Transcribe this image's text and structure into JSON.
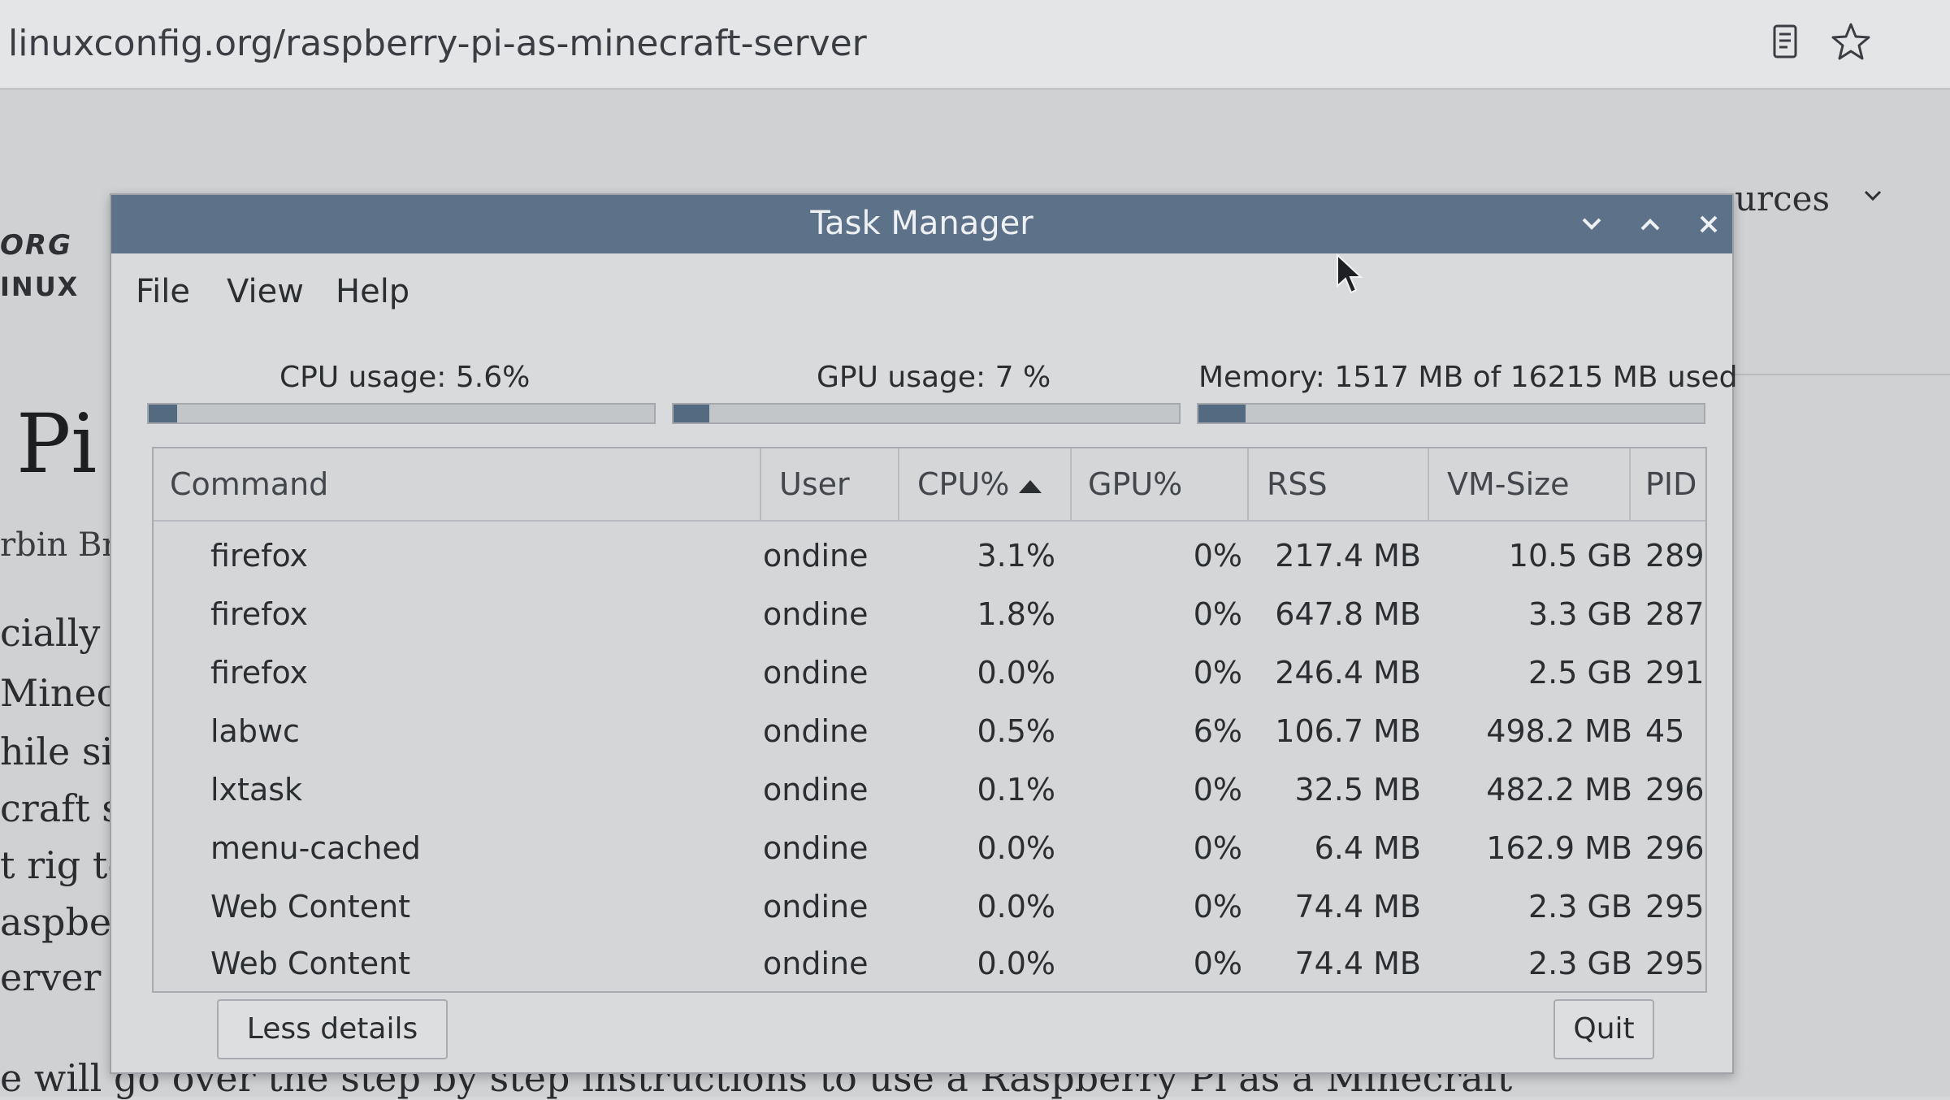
{
  "browser": {
    "url": "linuxconfig.org/raspberry-pi-as-minecraft-server",
    "icons": [
      "reader-view-icon",
      "bookmark-star-icon"
    ]
  },
  "page": {
    "nav_partial": "urces",
    "logo_line1": "ORG",
    "logo_line2": "INUX",
    "title_partial": "Pi a",
    "author_partial": "rbin Bro",
    "lines_partial": [
      "cially the",
      "Minecraf",
      "hile simu",
      "craft sessi",
      "t rig to ho",
      "aspberry P",
      "erver confi"
    ],
    "bottom_partial": "e will go over the step by step instructions to use a Raspberry Pi as a Minecraft"
  },
  "task_manager": {
    "title": "Task Manager",
    "menu": [
      "File",
      "View",
      "Help"
    ],
    "cpu_usage_label": "CPU usage: 5.6%",
    "cpu_usage_value": 5.6,
    "gpu_usage_label": "GPU usage: 7 %",
    "gpu_usage_value": 7,
    "memory_label": "Memory: 1517 MB of 16215 MB used",
    "memory_fraction": 0.0936,
    "columns": {
      "command": "Command",
      "user": "User",
      "cpu": "CPU%",
      "gpu": "GPU%",
      "rss": "RSS",
      "vm": "VM-Size",
      "pid": "PID"
    },
    "rows": [
      {
        "command": "firefox",
        "user": "ondine",
        "cpu": "3.1%",
        "gpu": "0%",
        "rss": "217.4 MB",
        "vm": "10.5 GB",
        "pid": "289"
      },
      {
        "command": "firefox",
        "user": "ondine",
        "cpu": "1.8%",
        "gpu": "0%",
        "rss": "647.8 MB",
        "vm": "3.3 GB",
        "pid": "287"
      },
      {
        "command": "firefox",
        "user": "ondine",
        "cpu": "0.0%",
        "gpu": "0%",
        "rss": "246.4 MB",
        "vm": "2.5 GB",
        "pid": "291"
      },
      {
        "command": "labwc",
        "user": "ondine",
        "cpu": "0.5%",
        "gpu": "6%",
        "rss": "106.7 MB",
        "vm": "498.2 MB",
        "pid": "45"
      },
      {
        "command": "lxtask",
        "user": "ondine",
        "cpu": "0.1%",
        "gpu": "0%",
        "rss": "32.5 MB",
        "vm": "482.2 MB",
        "pid": "296"
      },
      {
        "command": "menu-cached",
        "user": "ondine",
        "cpu": "0.0%",
        "gpu": "0%",
        "rss": "6.4 MB",
        "vm": "162.9 MB",
        "pid": "296"
      },
      {
        "command": "Web Content",
        "user": "ondine",
        "cpu": "0.0%",
        "gpu": "0%",
        "rss": "74.4 MB",
        "vm": "2.3 GB",
        "pid": "295"
      },
      {
        "command": "Web Content",
        "user": "ondine",
        "cpu": "0.0%",
        "gpu": "0%",
        "rss": "74.4 MB",
        "vm": "2.3 GB",
        "pid": "295"
      }
    ],
    "less_details_label": "Less details",
    "quit_label": "Quit"
  }
}
